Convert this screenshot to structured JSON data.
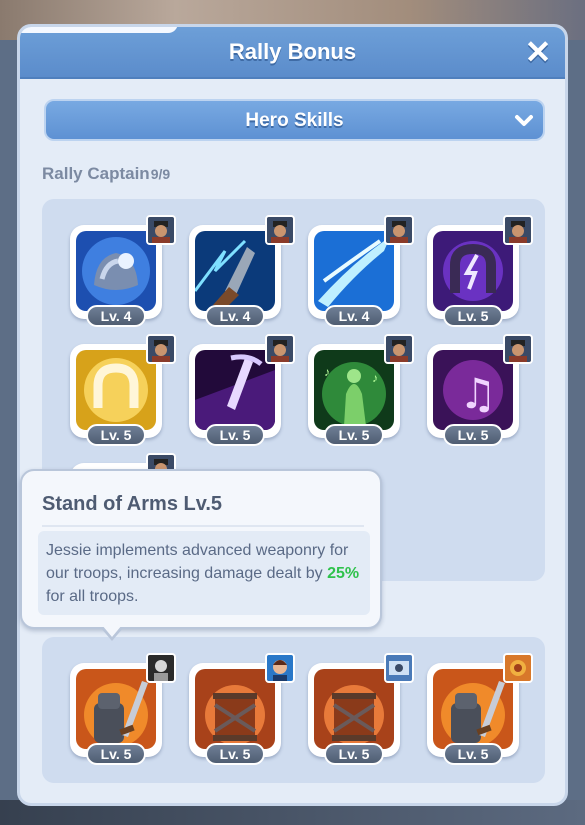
{
  "window": {
    "title": "Rally Bonus"
  },
  "dropdown": {
    "label": "Hero Skills"
  },
  "section": {
    "label": "Rally Captain",
    "count": "9/9"
  },
  "captain_skills": [
    {
      "level": "Lv. 4",
      "icon": "ice-shield-icon"
    },
    {
      "level": "Lv. 4",
      "icon": "lightning-blade-icon"
    },
    {
      "level": "Lv. 4",
      "icon": "ice-slash-icon"
    },
    {
      "level": "Lv. 5",
      "icon": "lightning-horseshoe-icon"
    },
    {
      "level": "Lv. 5",
      "icon": "golden-horseshoe-icon"
    },
    {
      "level": "Lv. 5",
      "icon": "pickaxe-strike-icon"
    },
    {
      "level": "Lv. 5",
      "icon": "green-spirit-icon"
    },
    {
      "level": "Lv. 5",
      "icon": "music-note-icon"
    },
    {
      "level": "",
      "icon": "hidden-skill-icon"
    }
  ],
  "joiner_skills": [
    {
      "level": "Lv. 5",
      "icon": "stand-of-arms-icon"
    },
    {
      "level": "Lv. 5",
      "icon": "fire-barrel-icon"
    },
    {
      "level": "Lv. 5",
      "icon": "fire-barrel-icon"
    },
    {
      "level": "Lv. 5",
      "icon": "stand-of-arms-icon"
    }
  ],
  "tooltip": {
    "title": "Stand of Arms Lv.5",
    "desc_before": "Jessie implements advanced weaponry for our troops, increasing damage dealt by ",
    "highlight": "25%",
    "desc_after": " for all troops.",
    "highlight_color": "#2fc24c"
  },
  "colors": {
    "titlebar": "#5b8ccb",
    "panel": "#e4ecf7",
    "badge": "#4f5d72"
  }
}
